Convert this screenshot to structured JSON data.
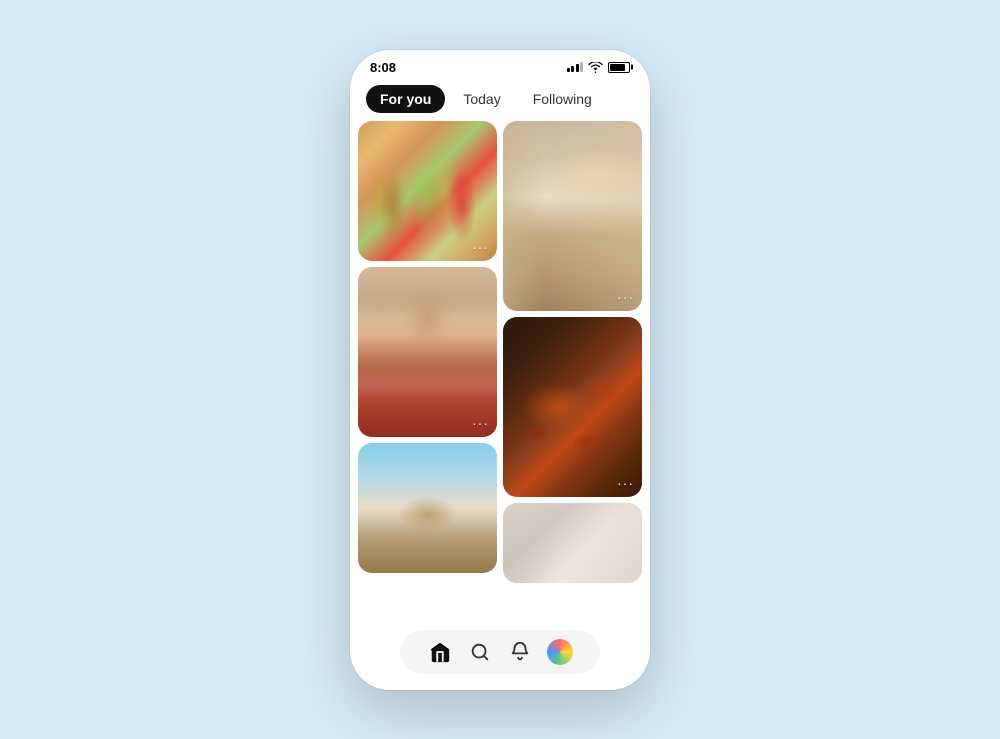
{
  "phone": {
    "status_bar": {
      "time": "8:08"
    },
    "tabs": [
      {
        "id": "for-you",
        "label": "For you",
        "active": true
      },
      {
        "id": "today",
        "label": "Today",
        "active": false
      },
      {
        "id": "following",
        "label": "Following",
        "active": false
      }
    ],
    "bottom_nav": {
      "items": [
        {
          "id": "home",
          "icon": "home-icon"
        },
        {
          "id": "search",
          "icon": "search-icon"
        },
        {
          "id": "notifications",
          "icon": "bell-icon"
        },
        {
          "id": "profile",
          "icon": "avatar-icon"
        }
      ]
    }
  },
  "more_dots": "···"
}
